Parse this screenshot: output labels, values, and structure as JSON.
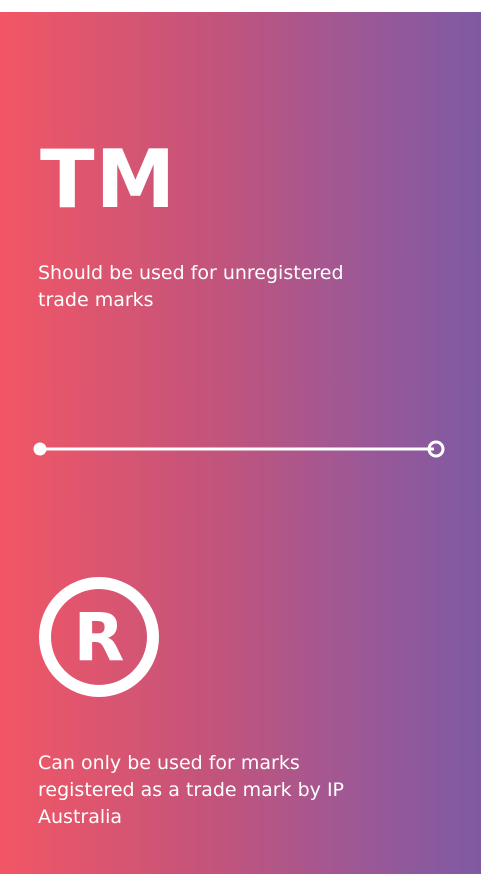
{
  "tm_section": {
    "symbol": "TM",
    "description": "Should be used for unregistered trade marks"
  },
  "registered_section": {
    "symbol": "R",
    "description": "Can only be used for marks registered as a trade mark by IP Australia"
  },
  "colors": {
    "gradient_left": "#f25665",
    "gradient_right": "#7e5aa3",
    "text": "#ffffff"
  }
}
